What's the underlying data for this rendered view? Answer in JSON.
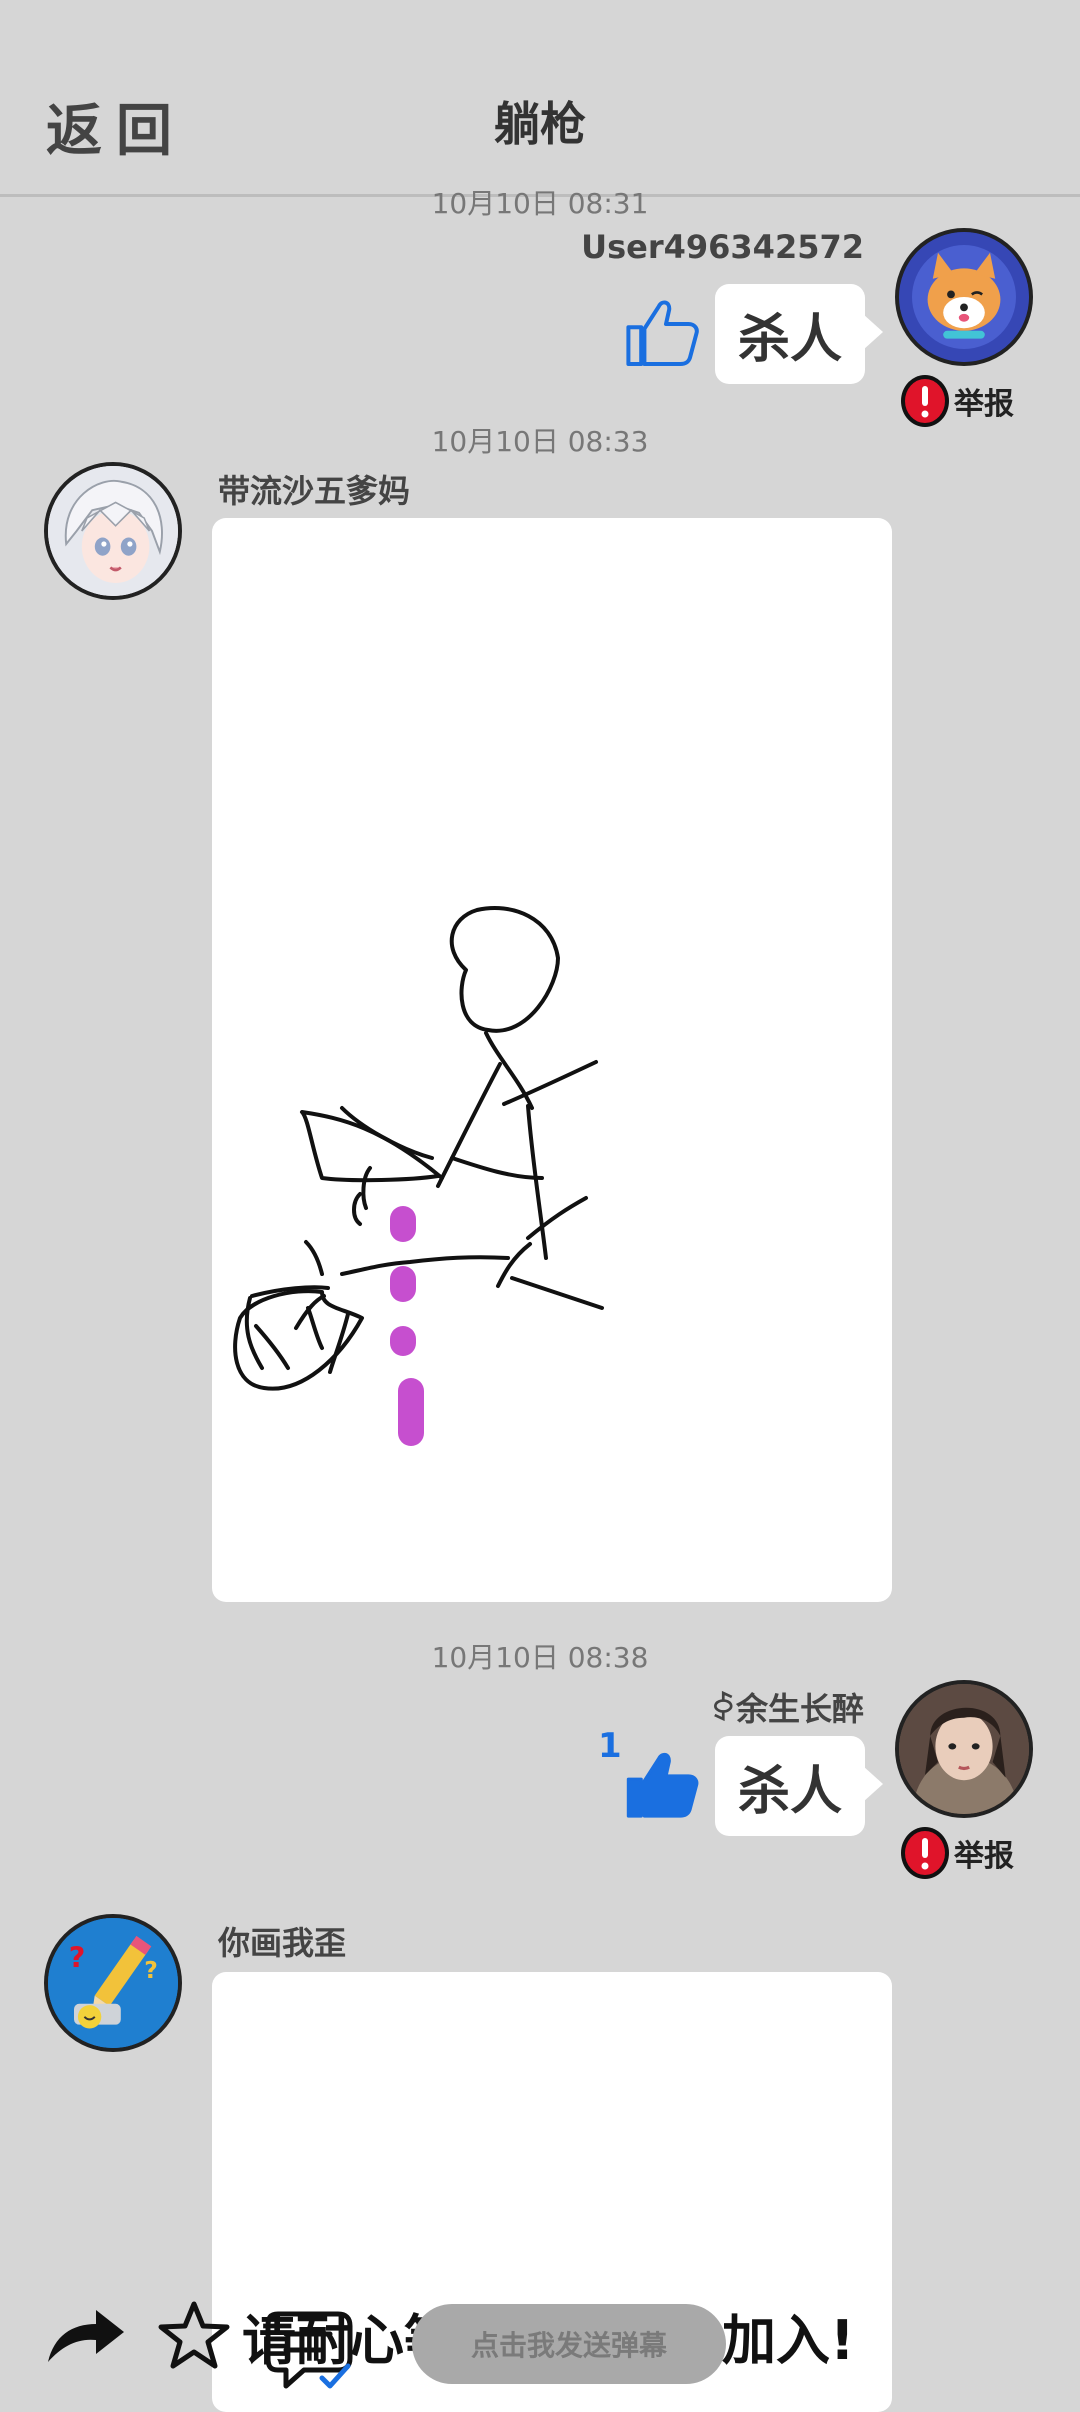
{
  "header": {
    "back_label": "返回",
    "title": "躺枪"
  },
  "messages": [
    {
      "timestamp": "10月10日  08:31",
      "user": "User496342572",
      "text": "杀人",
      "likes": "",
      "report_label": "举报"
    },
    {
      "timestamp": "10月10日  08:33",
      "user": "带流沙五爹妈"
    },
    {
      "timestamp": "10月10日  08:38",
      "user": "ꀆ余生长醉",
      "text": "杀人",
      "likes": "1",
      "report_label": "举报"
    },
    {
      "user": "你画我歪"
    }
  ],
  "bottom_bar": {
    "marquee_left": "请耐心等",
    "marquee_right": "加入!",
    "danmu_button": "点击我发送弹幕"
  },
  "icons": [
    "back",
    "share-icon",
    "star-icon",
    "chat-icon",
    "thumbs-up-icon",
    "report-icon"
  ],
  "colors": {
    "background": "#d6d6d6",
    "bubble": "#ffffff",
    "like_blue": "#1a6fe0",
    "report_red": "#e0142a",
    "drawing_magenta": "#c64fcf"
  }
}
